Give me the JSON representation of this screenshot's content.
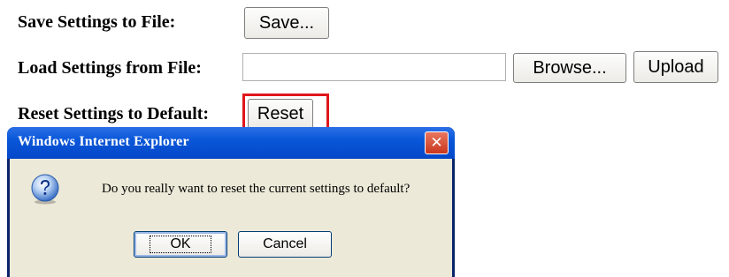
{
  "settings": {
    "save_label": "Save Settings to File:",
    "save_button": "Save...",
    "load_label": "Load Settings from File:",
    "load_file_value": "",
    "browse_button": "Browse...",
    "upload_button": "Upload",
    "reset_label": "Reset Settings to Default:",
    "reset_button": "Reset"
  },
  "highlight": {
    "color": "#e0161b",
    "target": "reset-button"
  },
  "dialog": {
    "title": "Windows Internet Explorer",
    "close_glyph": "✕",
    "icon": "question-icon",
    "message": "Do you really want to reset the current settings to default?",
    "ok_button": "OK",
    "cancel_button": "Cancel"
  },
  "colors": {
    "titlebar": "#0a57d9",
    "dialog_body": "#ece9d8",
    "close_button": "#c9381d"
  }
}
